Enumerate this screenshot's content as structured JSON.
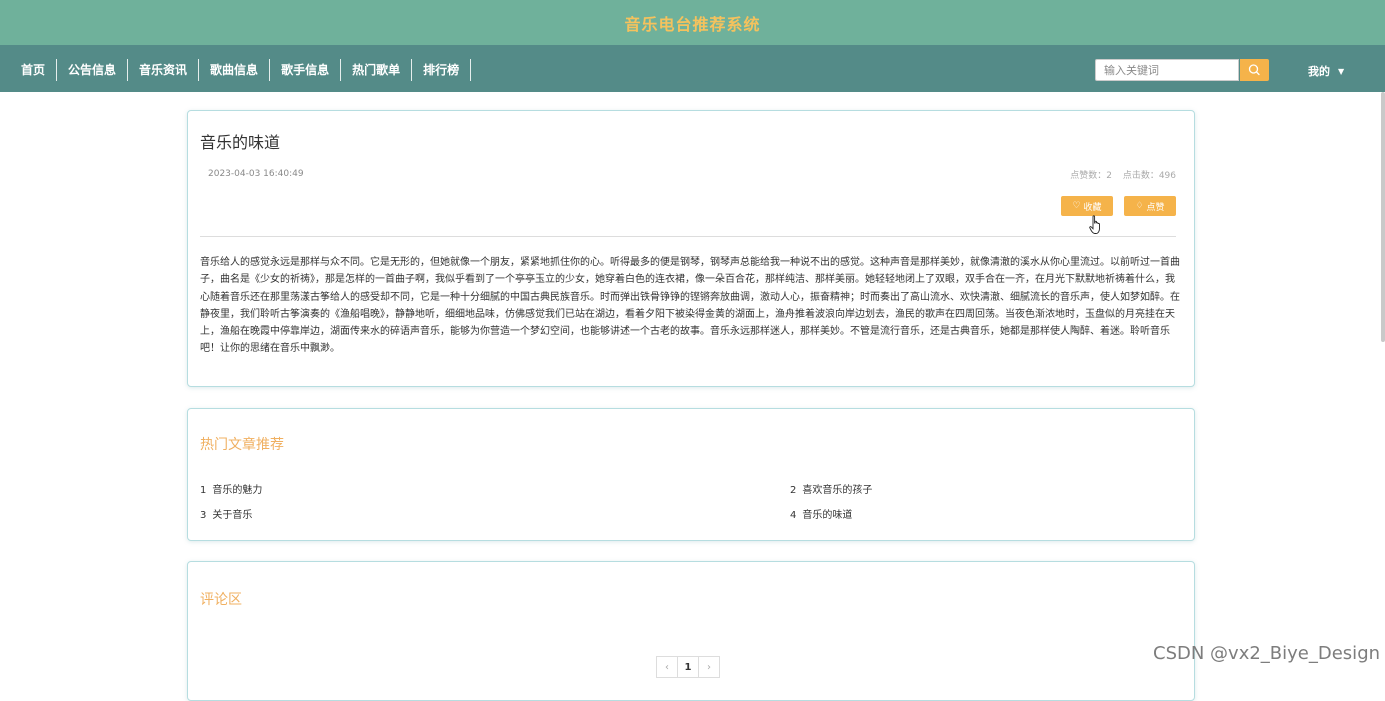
{
  "app": {
    "title": "音乐电台推荐系统"
  },
  "nav": {
    "items": [
      "首页",
      "公告信息",
      "音乐资讯",
      "歌曲信息",
      "歌手信息",
      "热门歌单",
      "排行榜"
    ],
    "search_placeholder": "输入关键词",
    "search_value": "",
    "user_menu_label": "我的",
    "user_menu_caret": "▼"
  },
  "article": {
    "title": "音乐的味道",
    "date": "2023-04-03 16:40:49",
    "likes_label": "点赞数：2",
    "clicks_label": "点击数：496",
    "favorite_icon": "♡",
    "favorite_label": "收藏",
    "like_icon": "♢",
    "like_label": "点赞",
    "content": "音乐给人的感觉永远是那样与众不同。它是无形的，但她就像一个朋友，紧紧地抓住你的心。听得最多的便是钢琴，钢琴声总能给我一种说不出的感觉。这种声音是那样美妙，就像清澈的溪水从你心里流过。以前听过一首曲子，曲名是《少女的祈祷》，那是怎样的一首曲子啊，我似乎看到了一个亭亭玉立的少女，她穿着白色的连衣裙，像一朵百合花，那样纯洁、那样美丽。她轻轻地闭上了双眼，双手合在一齐，在月光下默默地祈祷着什么，我心随着音乐还在那里荡漾古筝给人的感受却不同，它是一种十分细腻的中国古典民族音乐。时而弹出铁骨铮铮的铿锵奔放曲调，激动人心，振奋精神；时而奏出了高山流水、欢快清澈、细腻流长的音乐声，使人如梦如醉。在静夜里，我们聆听古筝演奏的《渔船唱晚》，静静地听，细细地品味，仿佛感觉我们已站在湖边，看着夕阳下被染得金黄的湖面上，渔舟推着波浪向岸边划去，渔民的歌声在四周回荡。当夜色渐浓地时，玉盘似的月亮挂在天上，渔船在晚霞中停靠岸边，湖面传来水的碎语声音乐，能够为你营造一个梦幻空间，也能够讲述一个古老的故事。音乐永远那样迷人，那样美妙。不管是流行音乐，还是古典音乐，她都是那样使人陶醉、着迷。聆听音乐吧！让你的思绪在音乐中飘渺。"
  },
  "hot_articles": {
    "title": "热门文章推荐",
    "items": [
      {
        "num": "1",
        "title": "音乐的魅力"
      },
      {
        "num": "2",
        "title": "喜欢音乐的孩子"
      },
      {
        "num": "3",
        "title": "关于音乐"
      },
      {
        "num": "4",
        "title": "音乐的味道"
      }
    ]
  },
  "comments": {
    "title": "评论区",
    "pagination": {
      "prev": "‹",
      "current": "1",
      "next": "›"
    }
  },
  "watermark": "CSDN @vx2_Biye_Design",
  "colors": {
    "title_bar": "#6fb19b",
    "nav_bar": "#548b88",
    "accent": "#f5b34a",
    "section_title": "#f0b061",
    "app_title": "#f5c25d"
  }
}
